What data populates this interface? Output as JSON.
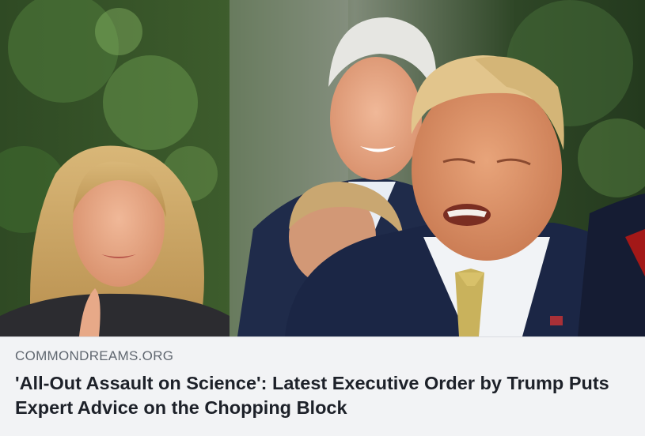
{
  "link_preview": {
    "image_alt": "Donald Trump speaking outdoors with smiling people behind him",
    "domain": "COMMONDREAMS.ORG",
    "headline": "'All-Out Assault on Science': Latest Executive Order by Trump Puts Expert Advice on the Chopping Block"
  },
  "colors": {
    "card_background": "#f2f3f5",
    "domain_text": "#606770",
    "headline_text": "#1d2129"
  }
}
